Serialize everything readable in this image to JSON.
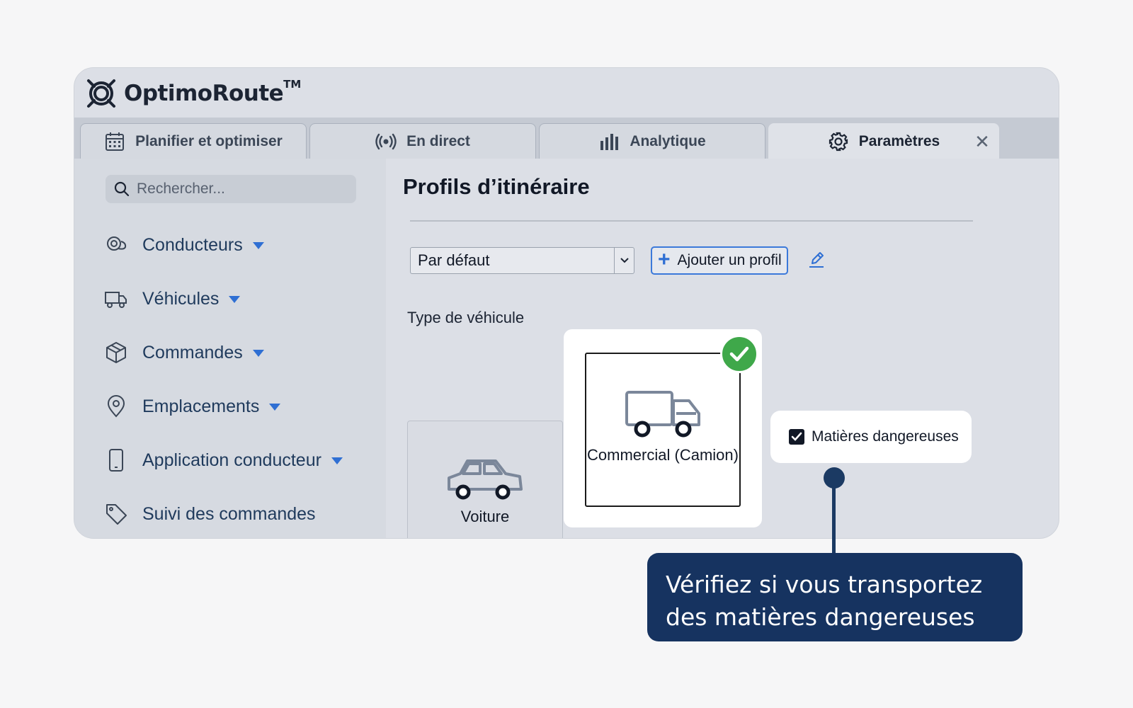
{
  "app": {
    "name": "OptimoRoute",
    "trademark": "TM"
  },
  "tabs": [
    {
      "label": "Planifier et optimiser",
      "icon": "calendar-icon",
      "active": false
    },
    {
      "label": "En direct",
      "icon": "broadcast-icon",
      "active": false
    },
    {
      "label": "Analytique",
      "icon": "bar-chart-icon",
      "active": false
    },
    {
      "label": "Paramètres",
      "icon": "gear-icon",
      "active": true
    }
  ],
  "tab_close_label": "✕",
  "sidebar": {
    "search": {
      "placeholder": "Rechercher..."
    },
    "items": [
      {
        "label": "Conducteurs",
        "icon": "drivers-icon",
        "has_caret": true
      },
      {
        "label": "Véhicules",
        "icon": "truck-icon",
        "has_caret": true
      },
      {
        "label": "Commandes",
        "icon": "box-icon",
        "has_caret": true
      },
      {
        "label": "Emplacements",
        "icon": "location-pin-icon",
        "has_caret": true
      },
      {
        "label": "Application conducteur",
        "icon": "phone-icon",
        "has_caret": true
      },
      {
        "label": "Suivi des commandes",
        "icon": "tag-icon",
        "has_caret": false
      }
    ]
  },
  "main": {
    "title": "Profils d’itinéraire",
    "profile_select": {
      "value": "Par défaut"
    },
    "add_profile_label": "Ajouter un profil",
    "vehicle_type_label": "Type de véhicule",
    "vehicles": [
      {
        "label": "Voiture",
        "icon": "car-icon",
        "selected": false
      },
      {
        "label": "Commercial (Camion)",
        "icon": "truck-icon",
        "selected": true
      }
    ],
    "hazmat": {
      "label": "Matières dangereuses",
      "checked": true
    }
  },
  "callout": {
    "line1": "Vérifiez si vous transportez",
    "line2": "des matières dangereuses"
  },
  "colors": {
    "accent": "#2f6fd3",
    "callout_bg": "#163360",
    "check_green": "#3fa84a"
  }
}
